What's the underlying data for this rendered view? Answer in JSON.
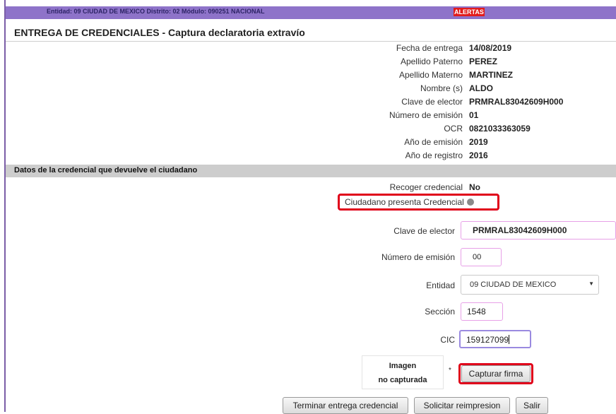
{
  "topbar": {
    "info": "Entidad: 09 CIUDAD DE MEXICO Distrito: 02 Módulo: 090251 NACIONAL",
    "alert": "ALERTAS"
  },
  "page_title": "ENTREGA DE CREDENCIALES - Captura declaratoria extravío",
  "details": [
    {
      "label": "Fecha de entrega",
      "value": "14/08/2019"
    },
    {
      "label": "Apellido Paterno",
      "value": "PEREZ"
    },
    {
      "label": "Apellido Materno",
      "value": "MARTINEZ"
    },
    {
      "label": "Nombre (s)",
      "value": "ALDO"
    },
    {
      "label": "Clave de elector",
      "value": "PRMRAL83042609H000"
    },
    {
      "label": "Número de emisión",
      "value": "01"
    },
    {
      "label": "OCR",
      "value": "0821033363059"
    },
    {
      "label": "Año de emisión",
      "value": "2019"
    },
    {
      "label": "Año de registro",
      "value": "2016"
    }
  ],
  "section_title": "Datos de la credencial que devuelve el ciudadano",
  "recoger": {
    "label": "Recoger credencial",
    "value": "No"
  },
  "presenta": {
    "label": "Ciudadano presenta Credencial"
  },
  "form": {
    "clave_label": "Clave de elector",
    "clave_value": "PRMRAL83042609H000",
    "emision_label": "Número de emisión",
    "emision_value": "00",
    "entidad_label": "Entidad",
    "entidad_value": "09 CIUDAD DE MEXICO",
    "seccion_label": "Sección",
    "seccion_value": "1548",
    "cic_label": "CIC",
    "cic_value": "159127099"
  },
  "signature": {
    "image_line1": "Imagen",
    "image_line2": "no capturada",
    "asterisk": "*",
    "capture_button": "Capturar firma"
  },
  "actions": {
    "terminar": "Terminar entrega credencial",
    "reimpresion": "Solicitar reimpresion",
    "salir": "Salir"
  },
  "colors": {
    "topbar": "#8e73c9",
    "alert": "#e21c1c",
    "highlight": "#e0001a",
    "section": "#cdcdcd"
  }
}
